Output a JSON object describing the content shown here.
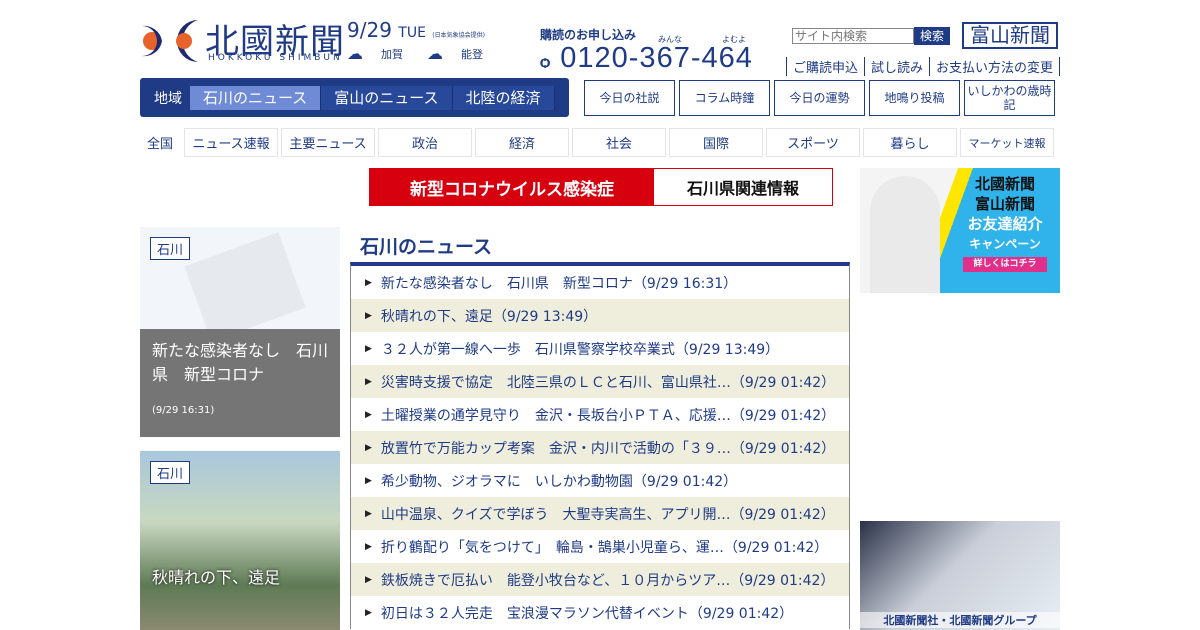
{
  "header": {
    "logo": "北國新聞",
    "logo_sub": "HOKKOKU SHIMBUN",
    "date": "9/29",
    "weekday": "TUE",
    "weather_source": "(日本気象協会提供)",
    "weather": [
      {
        "area": "加賀",
        "icon": "cloudy-sunny-icon"
      },
      {
        "area": "能登",
        "icon": "cloudy-sunny-icon"
      }
    ],
    "subscribe_label": "購読のお申し込み",
    "phone": "0120-367-464",
    "phone_ruby": [
      "みんな",
      "よむよ"
    ],
    "links": [
      "ご購読申込",
      "試し読み",
      "お支払い方法の変更"
    ],
    "search_placeholder": "サイト内検索",
    "search_button": "検索",
    "toyama_logo": "富山新聞"
  },
  "region_nav": {
    "label": "地域",
    "tabs": [
      "石川のニュース",
      "富山のニュース",
      "北陸の経済"
    ]
  },
  "quick_buttons": [
    "今日の社説",
    "コラム時鐘",
    "今日の運勢",
    "地鳴り投稿",
    "いしかわの歳時記"
  ],
  "national_nav": {
    "label": "全国",
    "items": [
      "ニュース速報",
      "主要ニュース",
      "政治",
      "経済",
      "社会",
      "国際",
      "スポーツ",
      "暮らし",
      "マーケット速報"
    ]
  },
  "covid_banner": {
    "left": "新型コロナウイルス感染症",
    "right": "石川県関連情報"
  },
  "cards": [
    {
      "tag": "石川",
      "title": "新たな感染者なし　石川県　新型コロナ",
      "time": "(9/29 16:31)"
    },
    {
      "tag": "石川",
      "title": "秋晴れの下、遠足"
    }
  ],
  "section_title": "石川のニュース",
  "news": [
    "新たな感染者なし　石川県　新型コロナ（9/29 16:31）",
    "秋晴れの下、遠足（9/29 13:49）",
    "３２人が第一線へ一歩　石川県警察学校卒業式（9/29 13:49）",
    "災害時支援で協定　北陸三県のＬＣと石川、富山県社…（9/29 01:42）",
    "土曜授業の通学見守り　金沢・長坂台小ＰＴＡ、応援…（9/29 01:42）",
    "放置竹で万能カップ考案　金沢・内川で活動の「３９…（9/29 01:42）",
    "希少動物、ジオラマに　いしかわ動物園（9/29 01:42）",
    "山中温泉、クイズで学ぼう　大聖寺実高生、アプリ開…（9/29 01:42）",
    "折り鶴配り「気をつけて」　輪島・鵠巣小児童ら、運…（9/29 01:42）",
    "鉄板焼きで厄払い　能登小牧台など、１０月からツア…（9/29 01:42）",
    "初日は３２人完走　宝浪漫マラソン代替イベント（9/29 01:42）"
  ],
  "ads": {
    "friend": {
      "lines": [
        "北國新聞",
        "富山新聞",
        "お友達紹介",
        "キャンペーン"
      ],
      "button": "詳しくはコチラ"
    },
    "group": "北國新聞社・北國新聞グループ"
  }
}
